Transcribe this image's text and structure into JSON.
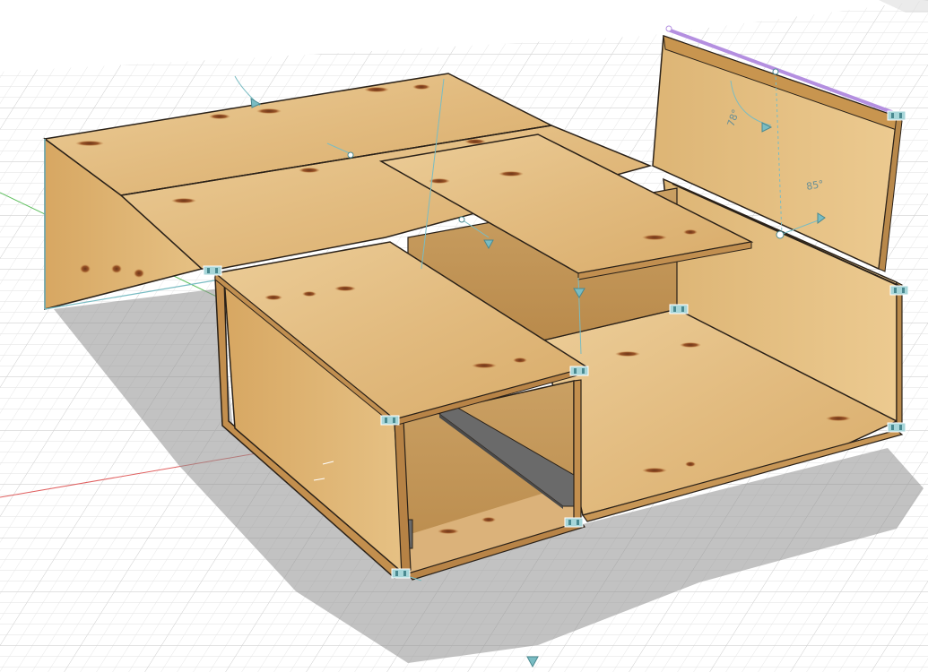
{
  "viewport": {
    "background": "#ffffff",
    "grid_minor_color": "#e4e4e4",
    "grid_major_color": "#cfcfcf",
    "x_axis_color": "#e06060",
    "y_axis_color": "#60c060",
    "gizmo_color": "#79bcc3"
  },
  "model": {
    "wood_light": "#e9c891",
    "wood_mid": "#d9ad6b",
    "wood_dark": "#c8954f",
    "edge_color": "#2a2118",
    "knot_color": "#8b4a24",
    "rail_color": "#6a6a6a",
    "selection_color": "#b48fe0"
  },
  "dimensions": {
    "angle_back": "78°",
    "angle_flap": "85°"
  },
  "icons": {
    "rotate_handle": "rotate-arc-icon",
    "move_handle": "move-arrow-icon",
    "hinge": "hinge-icon",
    "pivot": "pivot-point-icon"
  }
}
